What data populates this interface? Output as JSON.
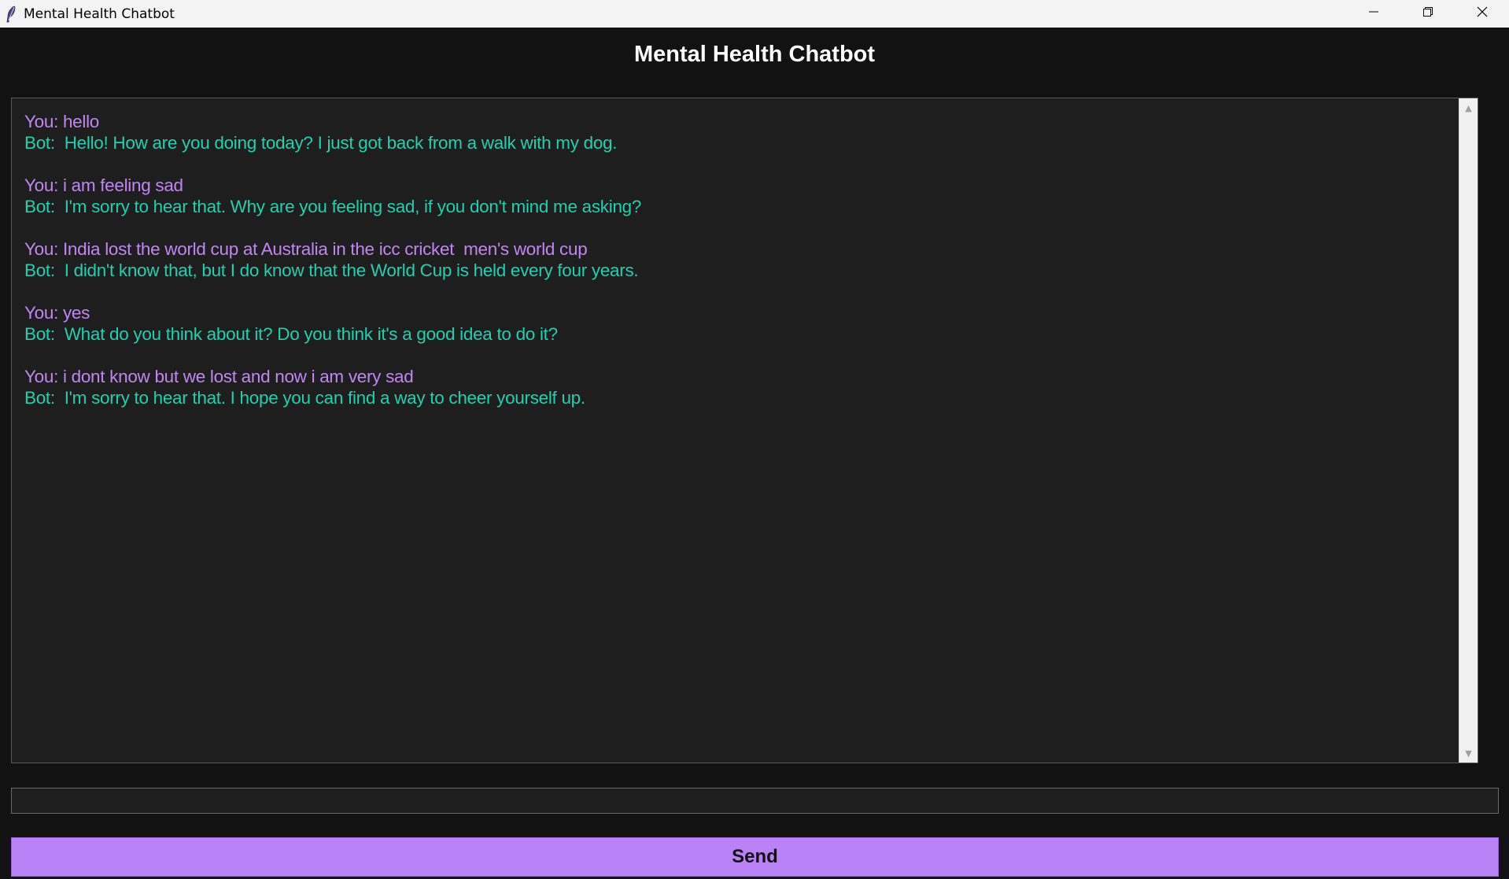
{
  "window": {
    "title": "Mental Health Chatbot",
    "app_icon": "feather-icon",
    "controls": [
      "minimize-icon",
      "restore-icon",
      "close-icon"
    ]
  },
  "header": {
    "title": "Mental Health Chatbot"
  },
  "chat": {
    "messages": [
      {
        "you": "You: hello",
        "bot": "Bot:  Hello! How are you doing today? I just got back from a walk with my dog."
      },
      {
        "you": "You: i am feeling sad",
        "bot": "Bot:  I'm sorry to hear that. Why are you feeling sad, if you don't mind me asking?"
      },
      {
        "you": "You: India lost the world cup at Australia in the icc cricket  men's world cup",
        "bot": "Bot:  I didn't know that, but I do know that the World Cup is held every four years."
      },
      {
        "you": "You: yes",
        "bot": "Bot:  What do you think about it? Do you think it's a good idea to do it?"
      },
      {
        "you": "You: i dont know but we lost and now i am very sad",
        "bot": "Bot:  I'm sorry to hear that. I hope you can find a way to cheer yourself up."
      }
    ]
  },
  "input": {
    "value": "",
    "placeholder": ""
  },
  "send_button": {
    "label": "Send"
  },
  "colors": {
    "background": "#121212",
    "chat_background": "#1e1e1e",
    "user_text": "#c285f2",
    "bot_text": "#1fd1b0",
    "send_button": "#b983f7"
  }
}
